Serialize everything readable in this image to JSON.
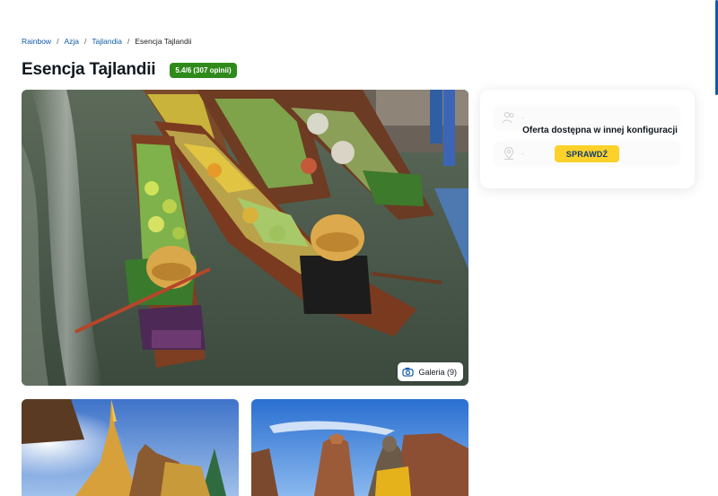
{
  "breadcrumb": {
    "items": [
      "Rainbow",
      "Azja",
      "Tajlandia"
    ],
    "separator": "/",
    "current": "Esencja Tajlandii"
  },
  "header": {
    "title": "Esencja Tajlandii",
    "rating": "5.4/6 (307 opinii)"
  },
  "hero": {
    "gallery_label": "Galeria (9)",
    "gallery_icon": "camera-icon"
  },
  "offer": {
    "message": "Oferta dostępna w innej konfiguracji",
    "button": "SPRAWDŹ",
    "placeholder_dash": "-"
  },
  "colors": {
    "link": "#0e5aa7",
    "rating_badge": "#2e8a1a",
    "cta": "#fcd12a",
    "cta_text": "#0d3b70"
  }
}
